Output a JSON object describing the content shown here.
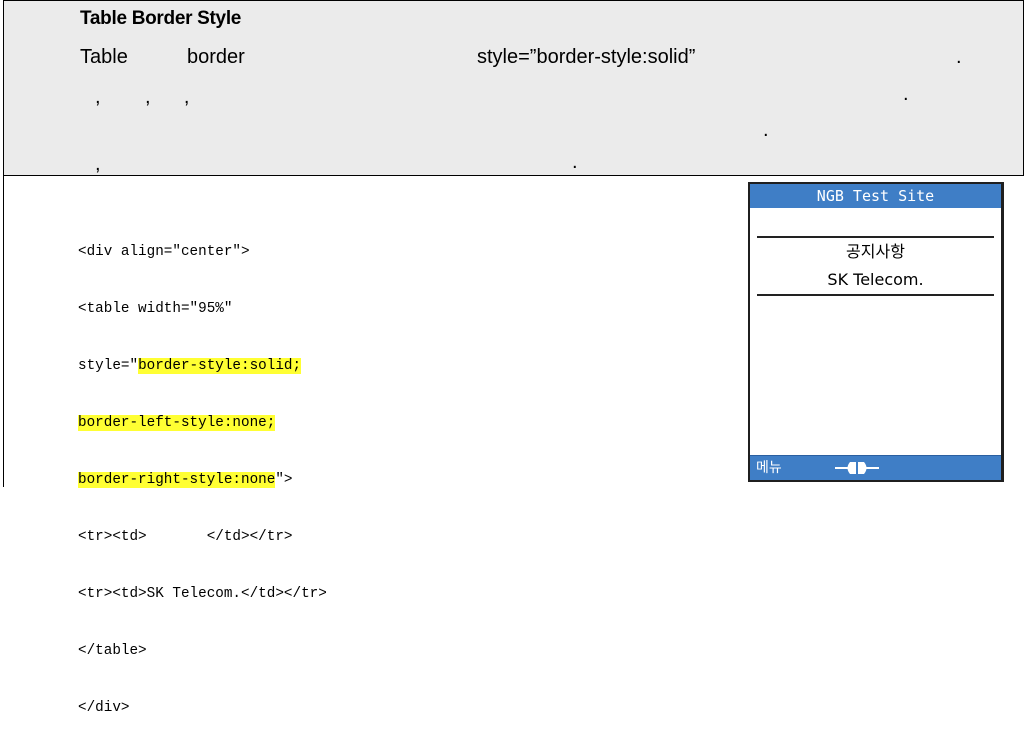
{
  "description": {
    "title": "Table Border Style",
    "line1_word1": "Table",
    "line1_word2": "border",
    "line1_style": "style=”border-style:solid”",
    "line1_dot": ".",
    "line2_marks": ",        ,      ,",
    "line2_dot": ".",
    "line3_dot": ".",
    "line4_comma": ",",
    "line4_dot": "."
  },
  "example": {
    "code_lines": [
      "<div align=\"center\">",
      "<table width=\"95%\"",
      "style=\"",
      "border-style:solid;",
      "border-left-style:none;",
      "border-right-style:none",
      "\">",
      "<tr><td>       </td></tr>",
      "<tr><td>SK Telecom.</td></tr>",
      "</table>",
      "</div>"
    ]
  },
  "phone": {
    "header_title": "NGB Test Site",
    "cell1": "공지사항",
    "cell2": "SK Telecom.",
    "menu_label": "메뉴",
    "nav_icon": "left-right-nav-icon",
    "colors": {
      "bar": "#3f7ec6",
      "highlight": "#ffff33",
      "description_bg": "#ebebeb"
    }
  }
}
